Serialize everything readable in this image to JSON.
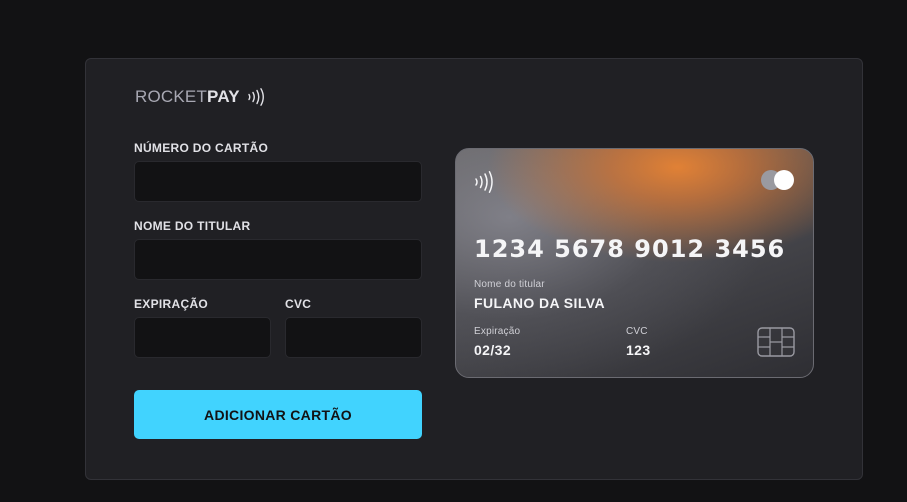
{
  "brand": {
    "part1": "ROCKET",
    "part2": "PAY"
  },
  "form": {
    "card_number_label": "NÚMERO DO CARTÃO",
    "card_number_value": "",
    "holder_label": "NOME DO TITULAR",
    "holder_value": "",
    "expiration_label": "EXPIRAÇÃO",
    "expiration_value": "",
    "cvc_label": "CVC",
    "cvc_value": "",
    "submit_label": "ADICIONAR CARTÃO"
  },
  "card": {
    "number": "1234 5678 9012 3456",
    "holder_caption": "Nome do titular",
    "holder_name": "FULANO DA SILVA",
    "expiration_caption": "Expiração",
    "expiration_value": "02/32",
    "cvc_caption": "CVC",
    "cvc_value": "123",
    "icons": [
      "contactless-icon",
      "card-brand-icon",
      "chip-icon"
    ]
  },
  "colors": {
    "background": "#121214",
    "panel": "#202024",
    "accent": "#41d3fe",
    "card_highlight": "#e8833a"
  }
}
